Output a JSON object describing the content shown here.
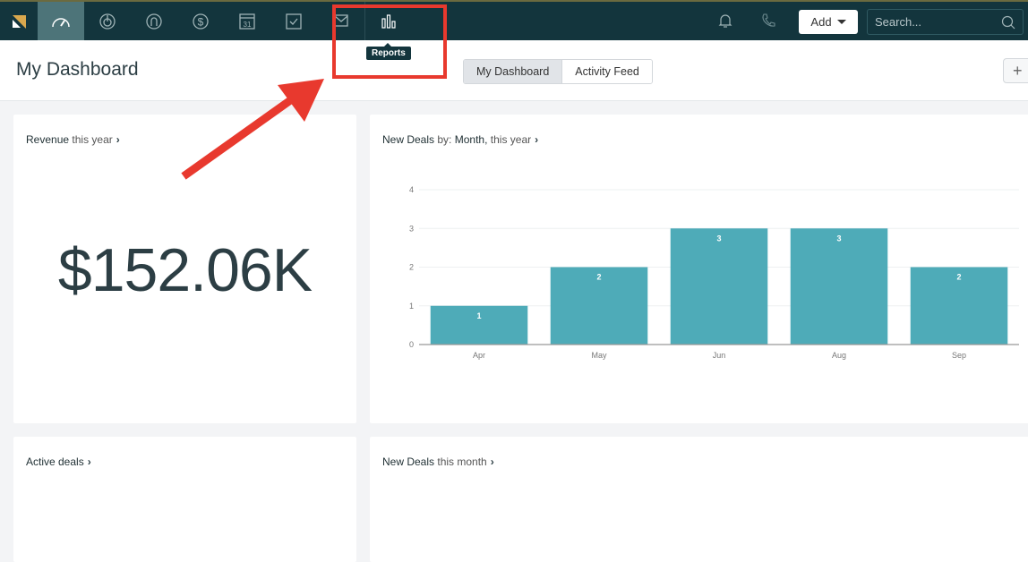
{
  "topbar": {
    "nav": [
      {
        "icon": "dashboard-gauge-icon",
        "active": true
      },
      {
        "icon": "leads-target-icon",
        "active": false
      },
      {
        "icon": "contacts-person-icon",
        "active": false
      },
      {
        "icon": "deals-dollar-icon",
        "active": false
      },
      {
        "icon": "calendar-icon",
        "active": false
      },
      {
        "icon": "tasks-check-icon",
        "active": false
      },
      {
        "icon": "communications-mail-icon",
        "active": false
      },
      {
        "icon": "reports-bar-chart-icon",
        "active": false
      }
    ],
    "tooltip": "Reports",
    "add_label": "Add",
    "search_placeholder": "Search..."
  },
  "header": {
    "title": "My Dashboard",
    "tabs": [
      {
        "label": "My Dashboard",
        "active": true
      },
      {
        "label": "Activity Feed",
        "active": false
      }
    ],
    "add_widget": "+"
  },
  "cards": {
    "revenue": {
      "title_bold": "Revenue",
      "title_rest": "this year",
      "value": "$152.06K"
    },
    "new_deals_month": {
      "title_bold": "New Deals",
      "title_mid": "by:",
      "title_bold2": "Month,",
      "title_rest": "this year"
    },
    "active_deals": {
      "title_bold": "Active deals"
    },
    "new_deals_this_month": {
      "title_bold": "New Deals",
      "title_rest": "this month"
    }
  },
  "colors": {
    "topbar": "#13353d",
    "bar": "#4eabb8",
    "annotation": "#e8392e"
  },
  "chart_data": {
    "type": "bar",
    "title": "New Deals by: Month, this year",
    "categories": [
      "Apr",
      "May",
      "Jun",
      "Aug",
      "Sep"
    ],
    "values": [
      1,
      2,
      3,
      3,
      2
    ],
    "xlabel": "",
    "ylabel": "",
    "ylim": [
      0,
      4
    ],
    "yticks": [
      0,
      1,
      2,
      3,
      4
    ],
    "grid": true,
    "data_labels": true
  }
}
